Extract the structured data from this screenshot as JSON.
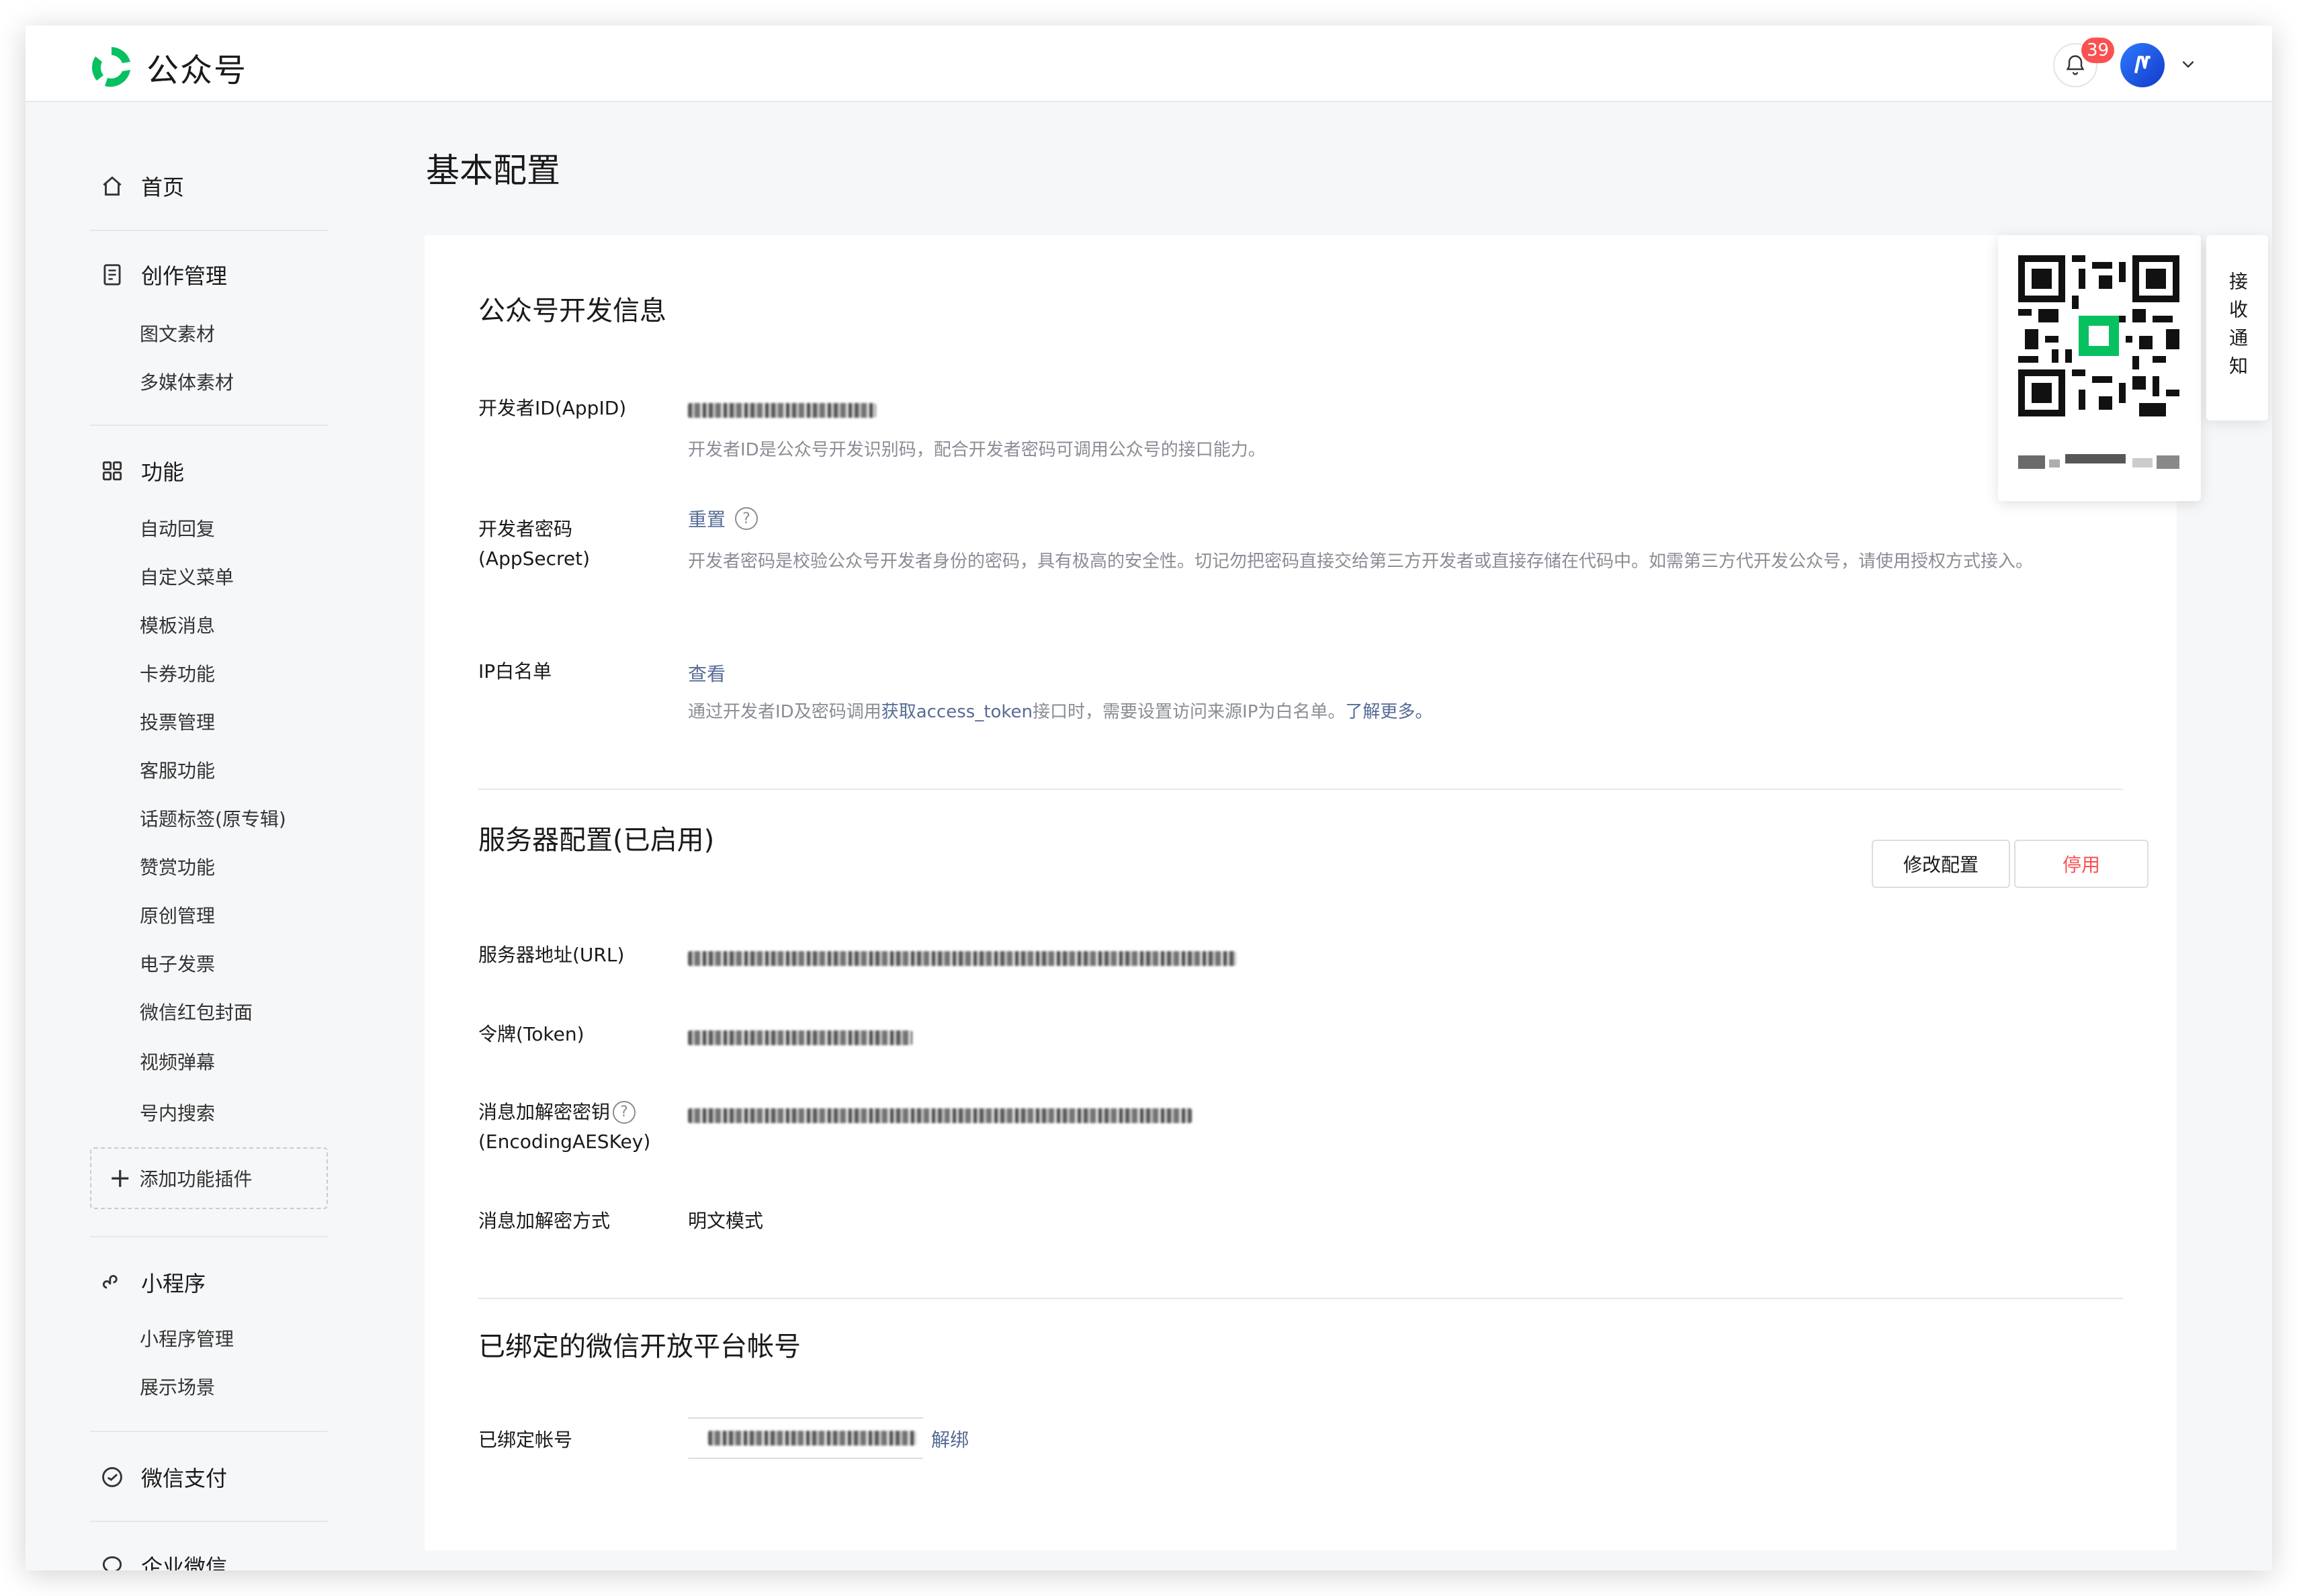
{
  "header": {
    "app_name": "公众号",
    "notification_count": "39"
  },
  "sidebar": {
    "home": "首页",
    "creation": {
      "label": "创作管理",
      "items": [
        "图文素材",
        "多媒体素材"
      ]
    },
    "features": {
      "label": "功能",
      "items": [
        "自动回复",
        "自定义菜单",
        "模板消息",
        "卡券功能",
        "投票管理",
        "客服功能",
        "话题标签(原专辑)",
        "赞赏功能",
        "原创管理",
        "电子发票",
        "微信红包封面",
        "视频弹幕",
        "号内搜索"
      ]
    },
    "add_plugin": "添加功能插件",
    "mini_program": {
      "label": "小程序",
      "items": [
        "小程序管理",
        "展示场景"
      ]
    },
    "wechat_pay": "微信支付",
    "enterprise_wechat": "企业微信"
  },
  "main": {
    "page_title": "基本配置",
    "dev_info": {
      "title": "公众号开发信息",
      "appid_label": "开发者ID(AppID)",
      "appid_desc": "开发者ID是公众号开发识别码，配合开发者密码可调用公众号的接口能力。",
      "secret_label": "开发者密码(AppSecret)",
      "secret_action": "重置",
      "secret_desc": "开发者密码是校验公众号开发者身份的密码，具有极高的安全性。切记勿把密码直接交给第三方开发者或直接存储在代码中。如需第三方代开发公众号，请使用授权方式接入。",
      "ip_label": "IP白名单",
      "ip_action": "查看",
      "ip_desc_1": "通过开发者ID及密码调用",
      "ip_desc_link": "获取access_token",
      "ip_desc_2": "接口时，需要设置访问来源IP为白名单。",
      "ip_desc_more": "了解更多。"
    },
    "server": {
      "title": "服务器配置(已启用)",
      "modify_button": "修改配置",
      "disable_button": "停用",
      "url_label": "服务器地址(URL)",
      "token_label": "令牌(Token)",
      "aes_label_1": "消息加解密密钥",
      "aes_label_2": "(EncodingAESKey)",
      "mode_label": "消息加解密方式",
      "mode_value": "明文模式"
    },
    "open_platform": {
      "title": "已绑定的微信开放平台帐号",
      "account_label": "已绑定帐号",
      "unbind": "解绑"
    }
  },
  "qr_panel": {
    "notify_label": "接收通知"
  },
  "colors": {
    "brand_green": "#07c160",
    "link_blue": "#576b95",
    "danger_red": "#fa5151"
  }
}
